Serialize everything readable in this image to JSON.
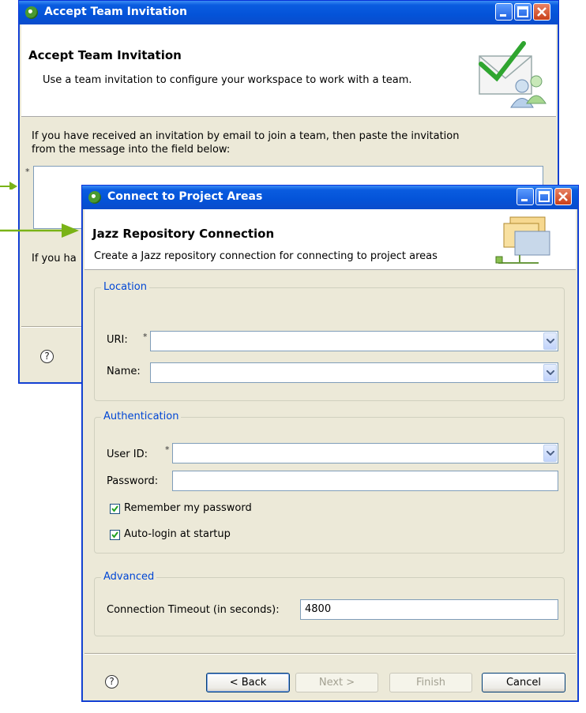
{
  "accept_dialog": {
    "title": "Accept Team Invitation",
    "header": "Accept Team Invitation",
    "description": "Use a team invitation to configure your workspace to work with a team.",
    "instructions_line1": "If you have received an invitation by email to join a team, then paste the invitation",
    "instructions_line2": "from the message into the field below:",
    "required_marker": "*",
    "partial_text": "If you ha",
    "help_glyph": "?"
  },
  "connect_dialog": {
    "title": "Connect to Project Areas",
    "header": "Jazz Repository Connection",
    "description": "Create a Jazz repository connection for connecting to project areas",
    "location": {
      "group_label": "Location",
      "uri_label": "URI:",
      "uri_value": "",
      "name_label": "Name:",
      "name_value": ""
    },
    "authentication": {
      "group_label": "Authentication",
      "user_id_label": "User ID:",
      "user_id_value": "",
      "password_label": "Password:",
      "password_value": "",
      "remember_label": "Remember my password",
      "remember_checked": true,
      "autologin_label": "Auto-login at startup",
      "autologin_checked": true
    },
    "advanced": {
      "group_label": "Advanced",
      "timeout_label": "Connection Timeout (in seconds):",
      "timeout_value": "4800"
    },
    "buttons": {
      "back": "< Back",
      "next": "Next >",
      "finish": "Finish",
      "cancel": "Cancel"
    },
    "required_marker": "*",
    "help_glyph": "?"
  },
  "colors": {
    "arrow": "#7ab317",
    "titlebar": "#0453d8",
    "group_title": "#0046d5",
    "dialog_bg": "#ece9d8"
  }
}
